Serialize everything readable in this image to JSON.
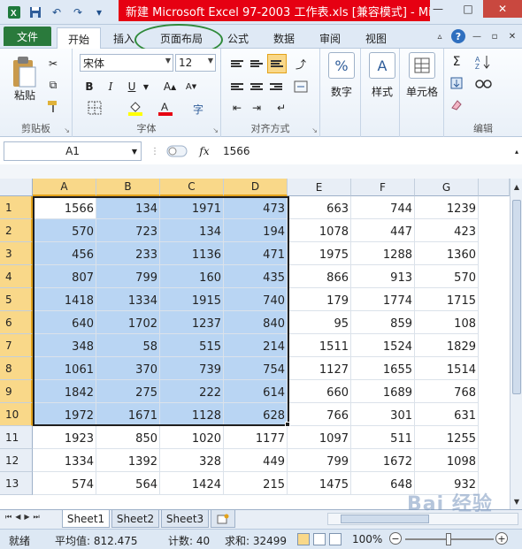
{
  "window": {
    "title": "新建 Microsoft Excel 97-2003 工作表.xls  [兼容模式] - Mi..."
  },
  "tabs": [
    {
      "label": "文件"
    },
    {
      "label": "开始"
    },
    {
      "label": "插入"
    },
    {
      "label": "页面布局"
    },
    {
      "label": "公式"
    },
    {
      "label": "数据"
    },
    {
      "label": "审阅"
    },
    {
      "label": "视图"
    }
  ],
  "ribbon": {
    "clipboard": {
      "paste_label": "粘贴",
      "group_label": "剪贴板"
    },
    "font": {
      "font_name": "宋体",
      "font_size": "12",
      "group_label": "字体",
      "bold": "B",
      "italic": "I",
      "underline": "U"
    },
    "alignment": {
      "group_label": "对齐方式"
    },
    "number": {
      "label": "数字",
      "symbol": "%"
    },
    "styles": {
      "label": "样式",
      "symbol": "A"
    },
    "cells": {
      "label": "单元格"
    },
    "editing": {
      "group_label": "编辑",
      "sum_symbol": "Σ"
    }
  },
  "formula_bar": {
    "name_box": "A1",
    "fx_label": "fx",
    "value": "1566"
  },
  "columns": [
    "A",
    "B",
    "C",
    "D",
    "E",
    "F",
    "G"
  ],
  "rows": [
    {
      "num": "1",
      "cells": [
        "1566",
        "134",
        "1971",
        "473",
        "663",
        "744",
        "1239"
      ]
    },
    {
      "num": "2",
      "cells": [
        "570",
        "723",
        "134",
        "194",
        "1078",
        "447",
        "423"
      ]
    },
    {
      "num": "3",
      "cells": [
        "456",
        "233",
        "1136",
        "471",
        "1975",
        "1288",
        "1360"
      ]
    },
    {
      "num": "4",
      "cells": [
        "807",
        "799",
        "160",
        "435",
        "866",
        "913",
        "570"
      ]
    },
    {
      "num": "5",
      "cells": [
        "1418",
        "1334",
        "1915",
        "740",
        "179",
        "1774",
        "1715"
      ]
    },
    {
      "num": "6",
      "cells": [
        "640",
        "1702",
        "1237",
        "840",
        "95",
        "859",
        "108"
      ]
    },
    {
      "num": "7",
      "cells": [
        "348",
        "58",
        "515",
        "214",
        "1511",
        "1524",
        "1829"
      ]
    },
    {
      "num": "8",
      "cells": [
        "1061",
        "370",
        "739",
        "754",
        "1127",
        "1655",
        "1514"
      ]
    },
    {
      "num": "9",
      "cells": [
        "1842",
        "275",
        "222",
        "614",
        "660",
        "1689",
        "768"
      ]
    },
    {
      "num": "10",
      "cells": [
        "1972",
        "1671",
        "1128",
        "628",
        "766",
        "301",
        "631"
      ]
    },
    {
      "num": "11",
      "cells": [
        "1923",
        "850",
        "1020",
        "1177",
        "1097",
        "511",
        "1255"
      ]
    },
    {
      "num": "12",
      "cells": [
        "1334",
        "1392",
        "328",
        "449",
        "799",
        "1672",
        "1098"
      ]
    },
    {
      "num": "13",
      "cells": [
        "574",
        "564",
        "1424",
        "215",
        "1475",
        "648",
        "932"
      ]
    }
  ],
  "sheets": [
    {
      "label": "Sheet1"
    },
    {
      "label": "Sheet2"
    },
    {
      "label": "Sheet3"
    }
  ],
  "status": {
    "ready": "就绪",
    "average": "平均值: 812.475",
    "count": "计数: 40",
    "sum": "求和: 32499",
    "zoom": "100%"
  },
  "watermark": "Bai 经验"
}
